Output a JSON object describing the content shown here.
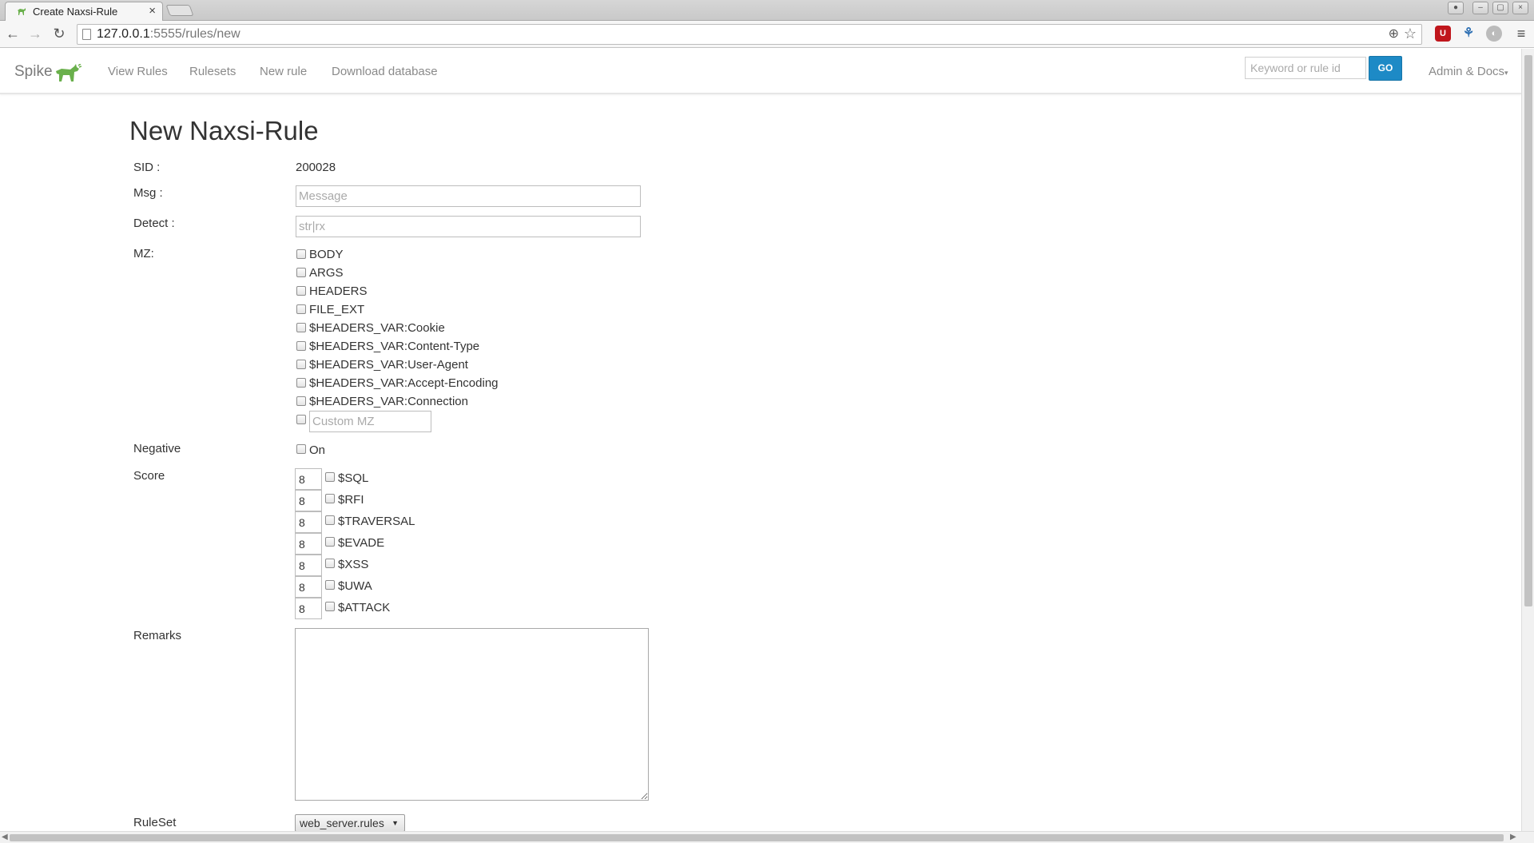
{
  "browser": {
    "tab_title": "Create Naxsi-Rule",
    "tab_close": "×",
    "url_host": "127.0.0.1",
    "url_path": ":5555/rules/new"
  },
  "navbar": {
    "brand": "Spike",
    "links": {
      "view_rules": "View Rules",
      "rulesets": "Rulesets",
      "new_rule": "New rule",
      "download_database": "Download database"
    },
    "search_placeholder": "Keyword or rule id",
    "go_label": "GO",
    "admin_label": "Admin & Docs",
    "admin_caret": "▾"
  },
  "form": {
    "title": "New Naxsi-Rule",
    "sid_label": "SID :",
    "sid_value": "200028",
    "msg_label": "Msg :",
    "msg_placeholder": "Message",
    "detect_label": "Detect :",
    "detect_placeholder": "str|rx",
    "mz_label": "MZ:",
    "mz_options": [
      "BODY",
      "ARGS",
      "HEADERS",
      "FILE_EXT",
      "$HEADERS_VAR:Cookie",
      "$HEADERS_VAR:Content-Type",
      "$HEADERS_VAR:User-Agent",
      "$HEADERS_VAR:Accept-Encoding",
      "$HEADERS_VAR:Connection"
    ],
    "custom_mz_placeholder": "Custom MZ",
    "negative_label": "Negative",
    "negative_option": "On",
    "score_label": "Score",
    "scores": [
      {
        "value": "8",
        "name": "$SQL"
      },
      {
        "value": "8",
        "name": "$RFI"
      },
      {
        "value": "8",
        "name": "$TRAVERSAL"
      },
      {
        "value": "8",
        "name": "$EVADE"
      },
      {
        "value": "8",
        "name": "$XSS"
      },
      {
        "value": "8",
        "name": "$UWA"
      },
      {
        "value": "8",
        "name": "$ATTACK"
      }
    ],
    "remarks_label": "Remarks",
    "ruleset_label": "RuleSet",
    "ruleset_value": "web_server.rules"
  },
  "colors": {
    "go_button": "#1d8ac6",
    "brand_logo": "#6ab04c"
  }
}
